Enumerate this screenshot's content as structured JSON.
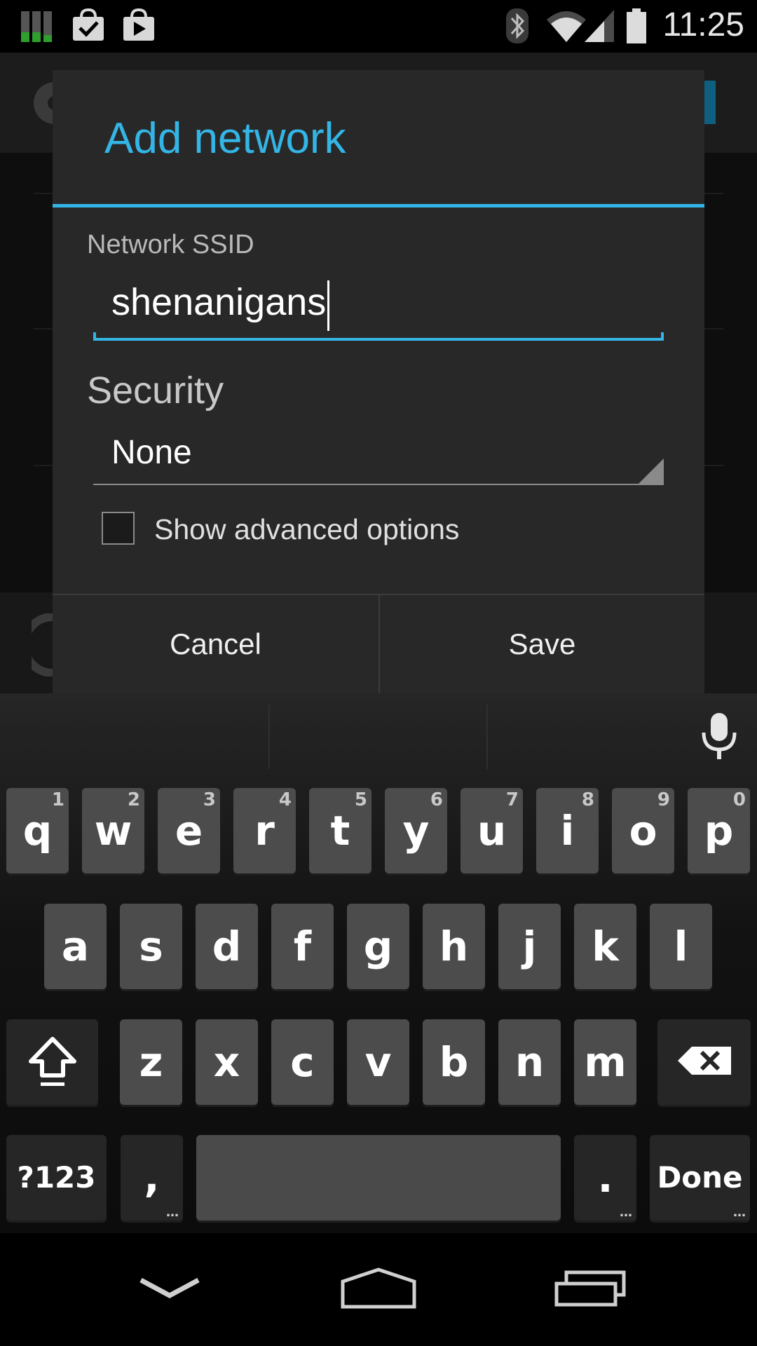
{
  "status_bar": {
    "time": "11:25",
    "left_icons": [
      "cell-data-icon",
      "bag-check-icon",
      "play-store-icon"
    ],
    "right_icons": [
      "bluetooth-icon",
      "wifi-icon",
      "cell-signal-icon",
      "battery-icon"
    ]
  },
  "dialog": {
    "title": "Add network",
    "ssid_label": "Network SSID",
    "ssid_value": "shenanigans",
    "security_label": "Security",
    "security_value": "None",
    "advanced_label": "Show advanced options",
    "advanced_checked": false,
    "cancel_label": "Cancel",
    "save_label": "Save"
  },
  "keyboard": {
    "row1": [
      {
        "key": "q",
        "hint": "1"
      },
      {
        "key": "w",
        "hint": "2"
      },
      {
        "key": "e",
        "hint": "3"
      },
      {
        "key": "r",
        "hint": "4"
      },
      {
        "key": "t",
        "hint": "5"
      },
      {
        "key": "y",
        "hint": "6"
      },
      {
        "key": "u",
        "hint": "7"
      },
      {
        "key": "i",
        "hint": "8"
      },
      {
        "key": "o",
        "hint": "9"
      },
      {
        "key": "p",
        "hint": "0"
      }
    ],
    "row2": [
      "a",
      "s",
      "d",
      "f",
      "g",
      "h",
      "j",
      "k",
      "l"
    ],
    "row3": [
      "z",
      "x",
      "c",
      "v",
      "b",
      "n",
      "m"
    ],
    "symbols_label": "?123",
    "comma_label": ",",
    "period_label": ".",
    "done_label": "Done",
    "mic": "mic-icon",
    "shift": "shift-icon",
    "backspace": "backspace-icon"
  },
  "nav_bar": {
    "buttons": [
      "back-icon",
      "home-icon",
      "recent-apps-icon"
    ]
  },
  "colors": {
    "accent": "#33b5e5",
    "dialog_bg": "#282828",
    "key_bg": "#4c4c4c",
    "key_dark_bg": "#262626"
  }
}
